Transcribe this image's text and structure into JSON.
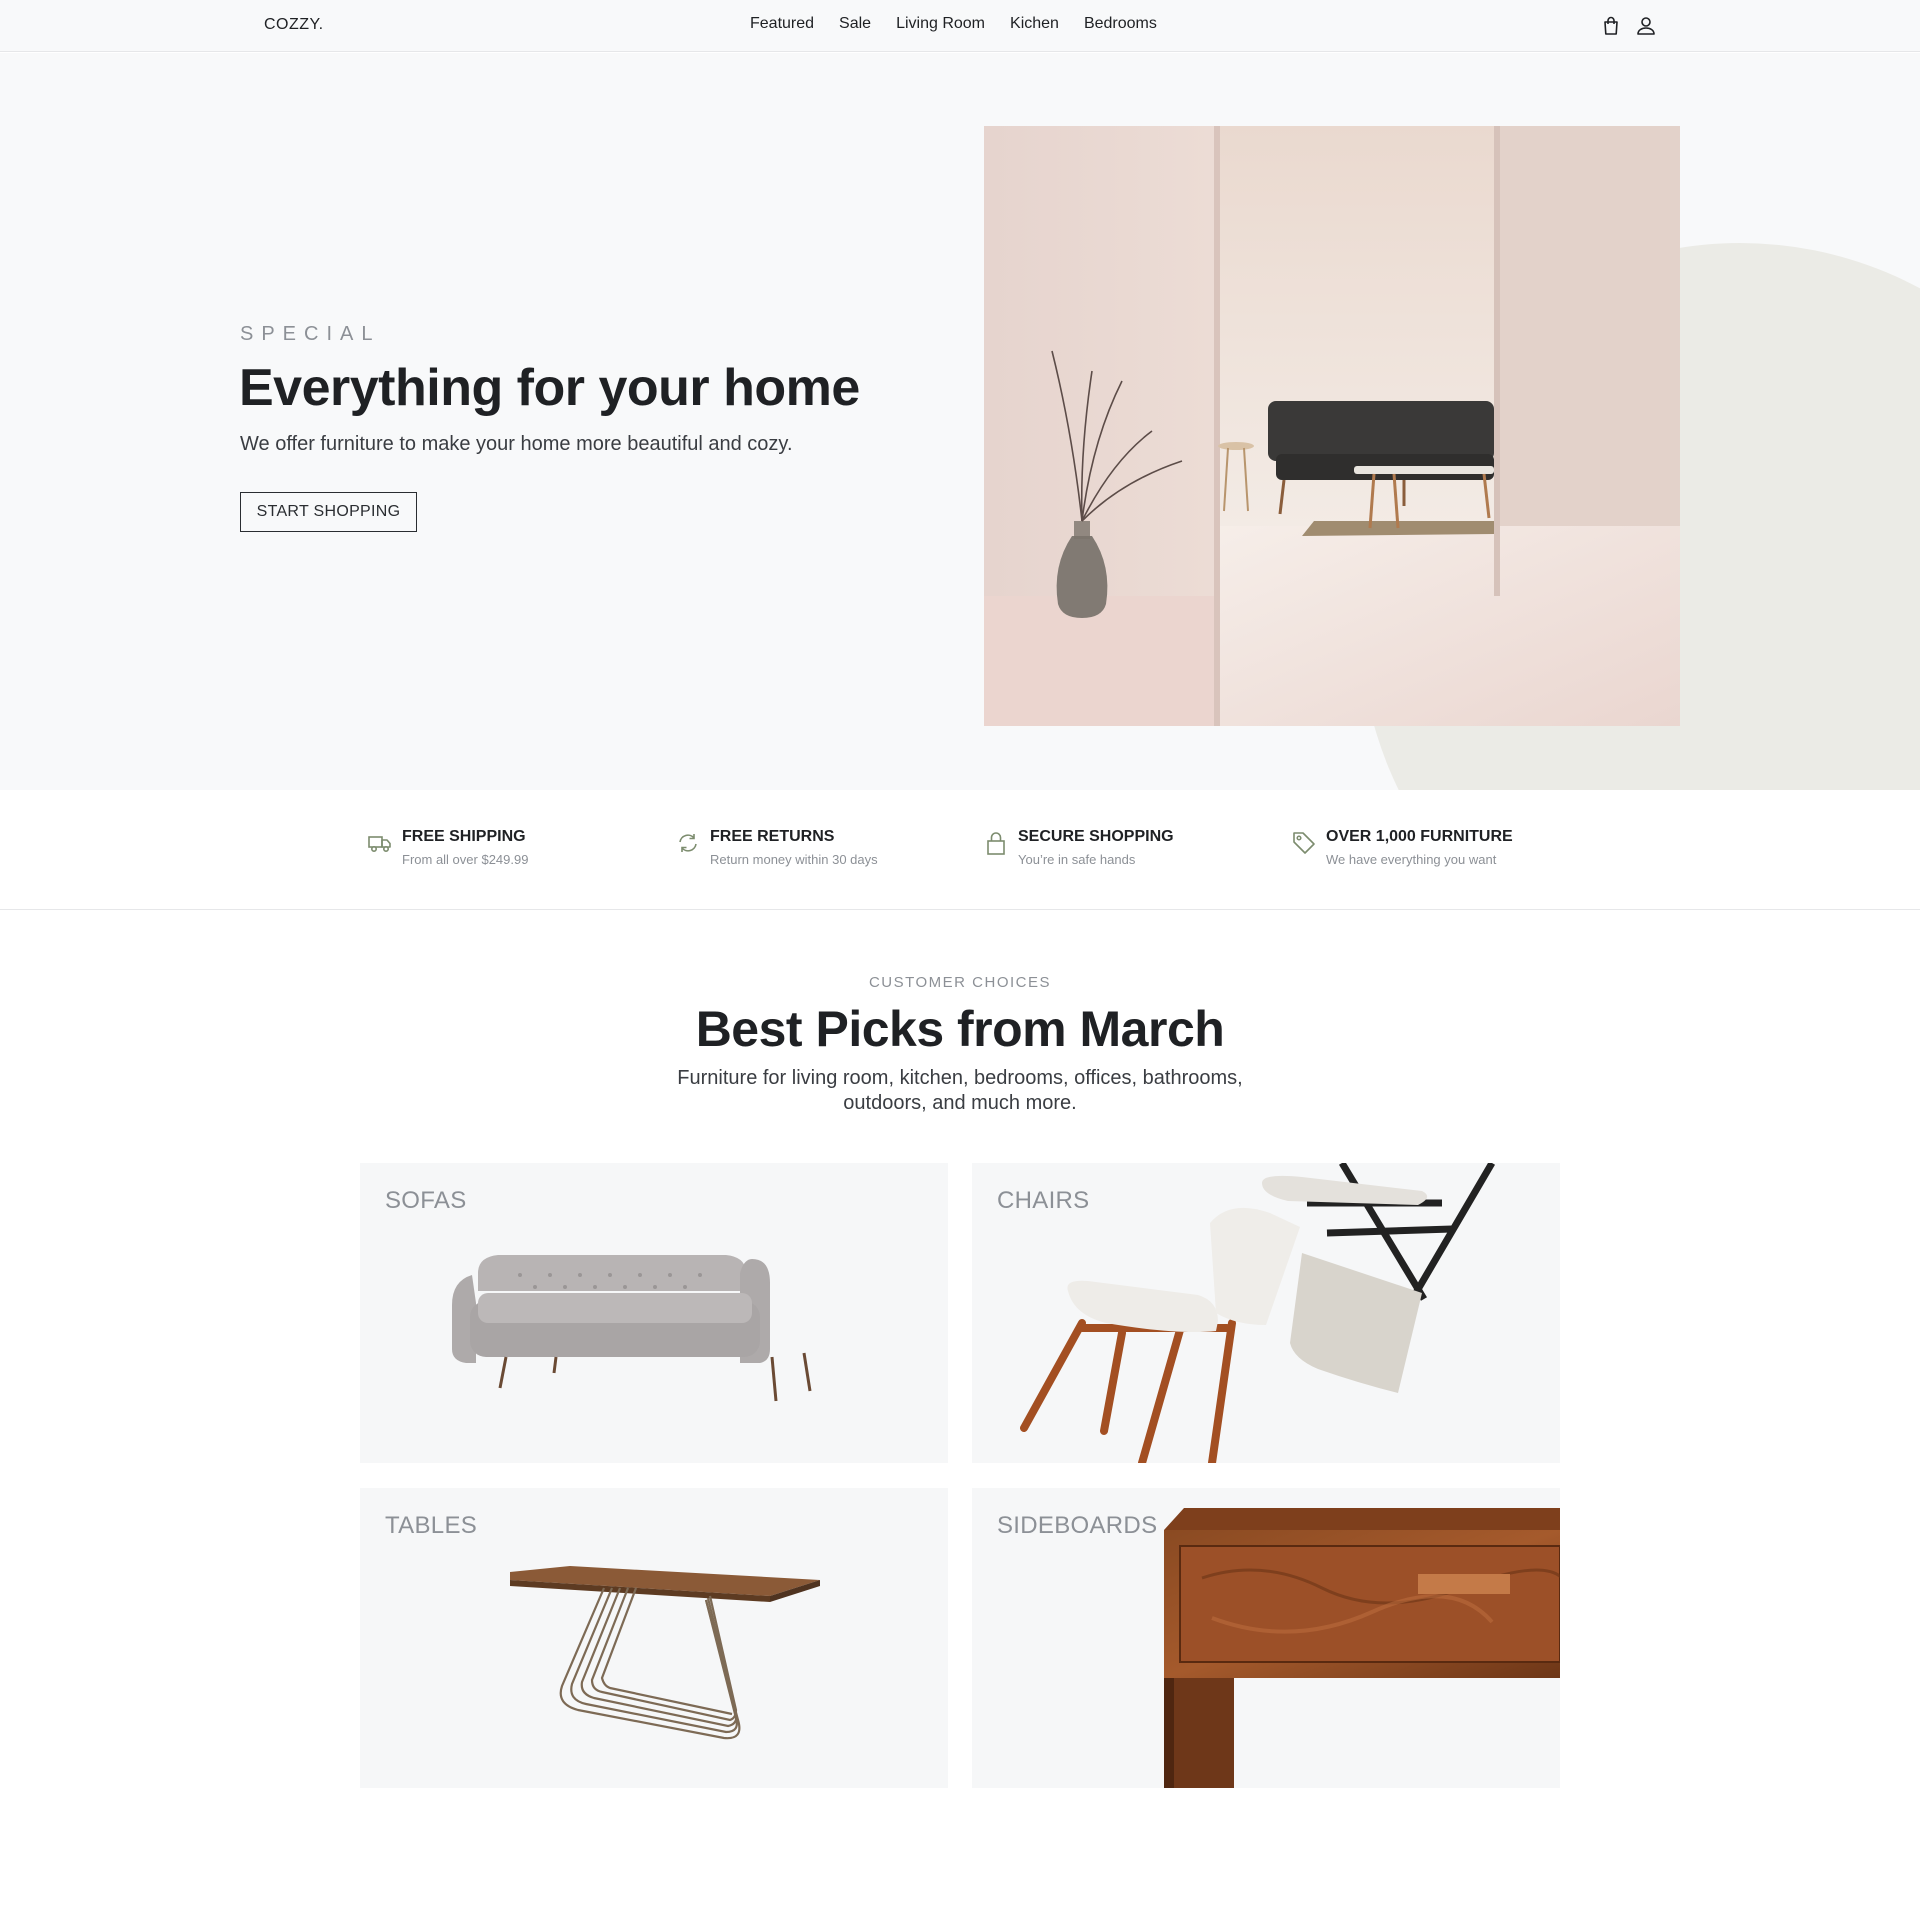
{
  "header": {
    "logo": "COZZY.",
    "nav": [
      "Featured",
      "Sale",
      "Living Room",
      "Kichen",
      "Bedrooms"
    ],
    "icons": [
      "shopping-bag-icon",
      "user-icon"
    ]
  },
  "hero": {
    "eyebrow": "SPECIAL",
    "title": "Everything for your home",
    "text": "We offer furniture to make your home more beautiful and cozy.",
    "button": "START SHOPPING"
  },
  "features": [
    {
      "icon": "truck-icon",
      "title": "FREE SHIPPING",
      "subtitle": "From all over $249.99"
    },
    {
      "icon": "refresh-icon",
      "title": "FREE RETURNS",
      "subtitle": "Return money within 30 days"
    },
    {
      "icon": "lock-icon",
      "title": "SECURE SHOPPING",
      "subtitle": "You’re in safe hands"
    },
    {
      "icon": "tag-icon",
      "title": "OVER 1,000 FURNITURE",
      "subtitle": "We have everything you want"
    }
  ],
  "section": {
    "eyebrow": "CUSTOMER CHOICES",
    "title": "Best Picks from March",
    "text": "Furniture for living room, kitchen, bedrooms, offices, bathrooms, outdoors, and much more."
  },
  "categories": [
    {
      "label": "SOFAS"
    },
    {
      "label": "CHAIRS"
    },
    {
      "label": "TABLES"
    },
    {
      "label": "SIDEBOARDS"
    }
  ],
  "colors": {
    "text": "#1f2124",
    "muted": "#8c9096",
    "accent_icon": "#7c8c6e",
    "hero_bg": "#f8f9fa",
    "blob": "#ebebe6"
  }
}
